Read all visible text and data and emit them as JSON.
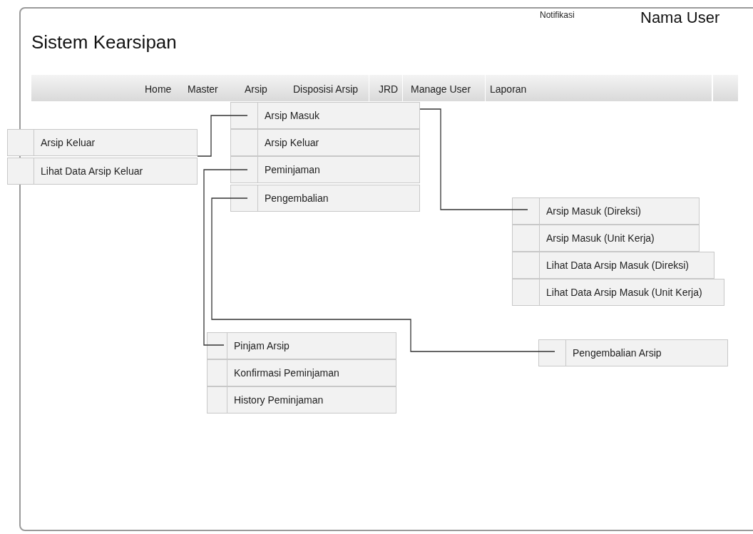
{
  "app_title": "Sistem Kearsipan",
  "notification": "Notifikasi",
  "user_name": "Nama User",
  "nav": [
    "Home",
    "Master",
    "Arsip",
    "Disposisi Arsip",
    "JRD",
    "Manage User",
    "Laporan"
  ],
  "menus": [
    {
      "items": [
        "Arsip Keluar",
        "Lihat Data Arsip Keluar"
      ]
    },
    {
      "items": [
        "Arsip Masuk",
        "Arsip Keluar",
        "Peminjaman",
        "Pengembalian"
      ]
    },
    {
      "items": [
        "Arsip Masuk (Direksi)",
        "Arsip Masuk (Unit Kerja)",
        "Lihat Data Arsip Masuk (Direksi)",
        "Lihat Data Arsip Masuk (Unit Kerja)"
      ]
    },
    {
      "items": [
        "Pinjam Arsip",
        "Konfirmasi Peminjaman",
        "History Peminjaman"
      ]
    },
    {
      "items": [
        "Pengembalian Arsip"
      ]
    }
  ]
}
